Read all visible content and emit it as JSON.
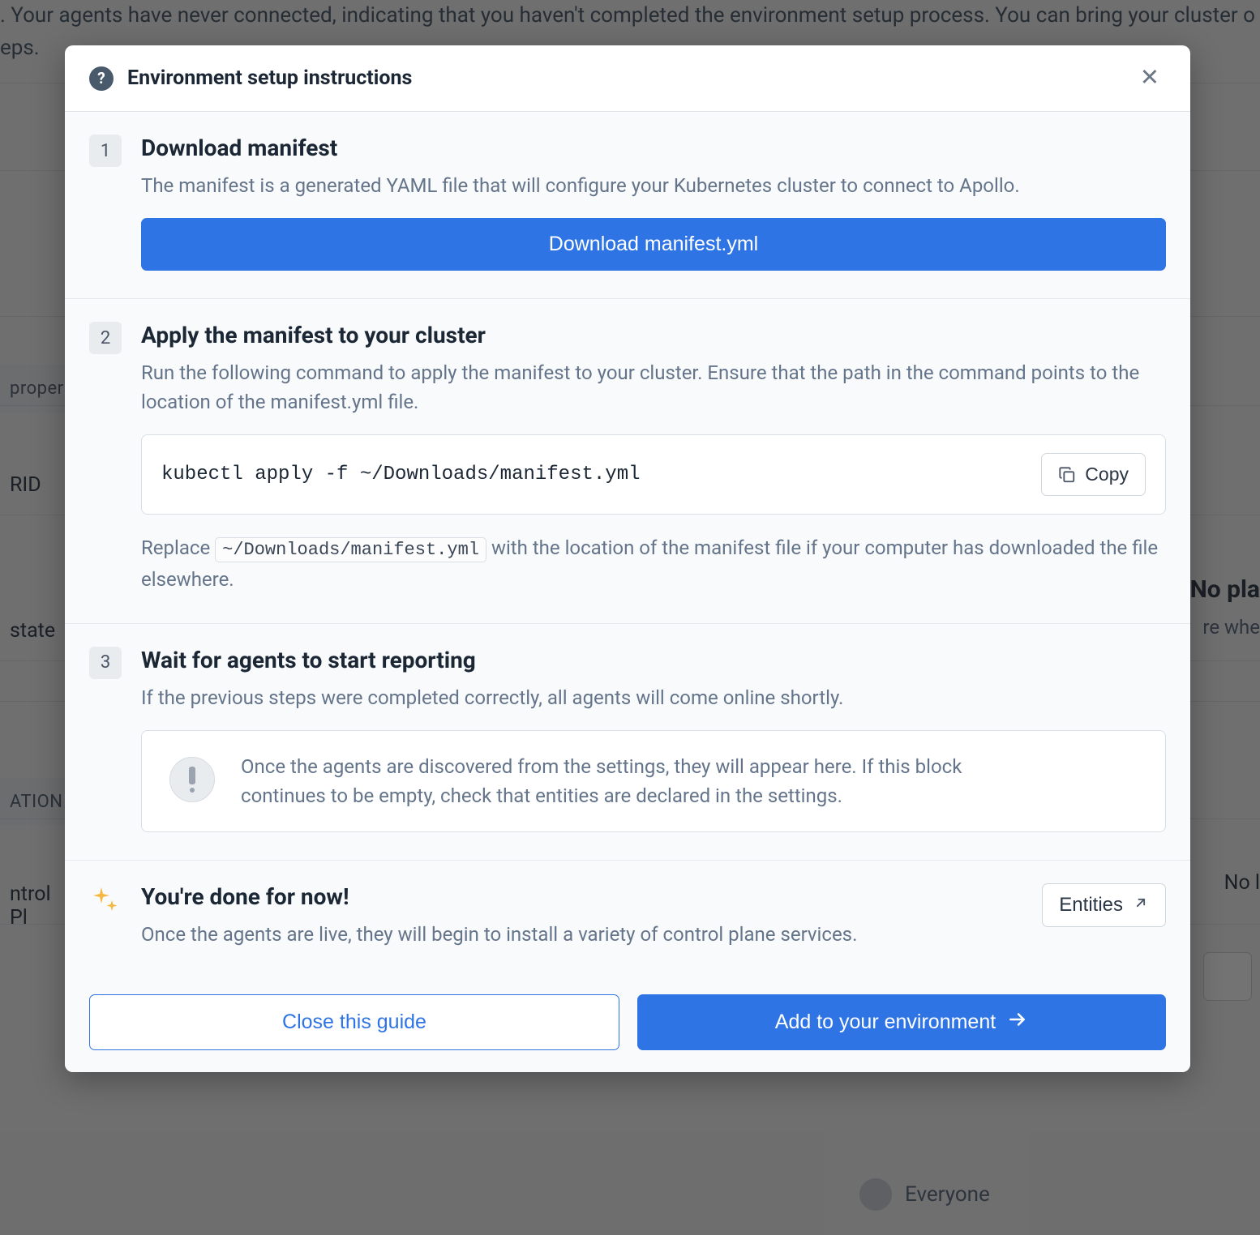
{
  "background": {
    "banner_text": ". Your agents have never connected, indicating that you haven't completed the environment setup process. You can bring your cluster o",
    "banner_suffix": "eps.",
    "label_proper": "proper",
    "cell_rid": "RID",
    "cell_state": "state",
    "label_ation": "ATION",
    "cell_ntrol": "ntrol Pl",
    "right_heading": "No pla",
    "right_sub": "re whe",
    "right_nol": "No l",
    "avatar_text": "Everyone"
  },
  "modal": {
    "title": "Environment setup instructions",
    "steps": [
      {
        "number": "1",
        "title": "Download manifest",
        "description": "The manifest is a generated YAML file that will configure your Kubernetes cluster to connect to Apollo.",
        "button_label": "Download manifest.yml"
      },
      {
        "number": "2",
        "title": "Apply the manifest to your cluster",
        "description": "Run the following command to apply the manifest to your cluster. Ensure that the path in the command points to the location of the manifest.yml file.",
        "code": "kubectl apply -f ~/Downloads/manifest.yml",
        "copy_label": "Copy",
        "replace_prefix": "Replace ",
        "replace_code": "~/Downloads/manifest.yml",
        "replace_suffix": " with the location of the manifest file if your computer has downloaded the file elsewhere."
      },
      {
        "number": "3",
        "title": "Wait for agents to start reporting",
        "description": "If the previous steps were completed correctly, all agents will come online shortly.",
        "info_text": "Once the agents are discovered from the settings, they will appear here. If this block continues to be empty, check that entities are declared in the settings."
      }
    ],
    "done": {
      "title": "You're done for now!",
      "description": "Once the agents are live, they will begin to install a variety of control plane services.",
      "entities_label": "Entities"
    },
    "footer": {
      "close_label": "Close this guide",
      "add_label": "Add to your environment"
    }
  }
}
